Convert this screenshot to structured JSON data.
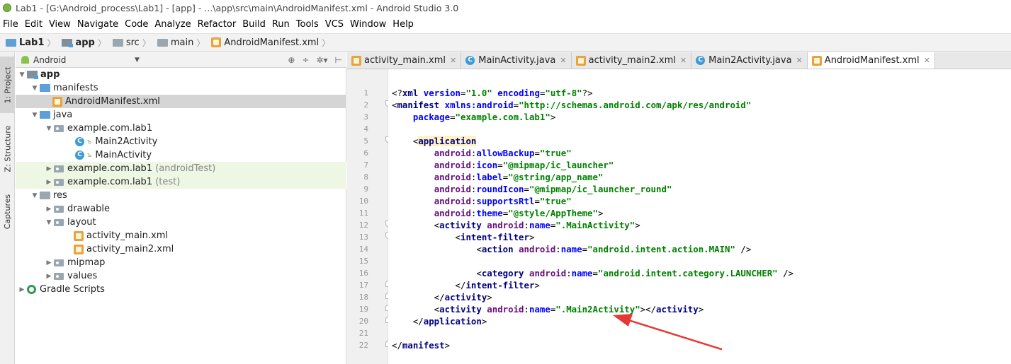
{
  "window": {
    "title": "Lab1 - [G:\\Android_process\\Lab1] - [app] - ...\\app\\src\\main\\AndroidManifest.xml - Android Studio 3.0"
  },
  "menu": [
    "File",
    "Edit",
    "View",
    "Navigate",
    "Code",
    "Analyze",
    "Refactor",
    "Build",
    "Run",
    "Tools",
    "VCS",
    "Window",
    "Help"
  ],
  "breadcrumb": [
    "Lab1",
    "app",
    "src",
    "main",
    "AndroidManifest.xml"
  ],
  "left_strip": {
    "project": "1: Project",
    "structure": "Z: Structure",
    "captures": "Captures"
  },
  "project_panel": {
    "view": "Android",
    "tree": [
      {
        "label": "app",
        "extra": ""
      },
      {
        "label": "manifests",
        "extra": ""
      },
      {
        "label": "AndroidManifest.xml",
        "extra": ""
      },
      {
        "label": "java",
        "extra": ""
      },
      {
        "label": "example.com.lab1",
        "extra": ""
      },
      {
        "label": "Main2Activity",
        "extra": ""
      },
      {
        "label": "MainActivity",
        "extra": ""
      },
      {
        "label": "example.com.lab1",
        "extra": "(androidTest)"
      },
      {
        "label": "example.com.lab1",
        "extra": "(test)"
      },
      {
        "label": "res",
        "extra": ""
      },
      {
        "label": "drawable",
        "extra": ""
      },
      {
        "label": "layout",
        "extra": ""
      },
      {
        "label": "activity_main.xml",
        "extra": ""
      },
      {
        "label": "activity_main2.xml",
        "extra": ""
      },
      {
        "label": "mipmap",
        "extra": ""
      },
      {
        "label": "values",
        "extra": ""
      },
      {
        "label": "Gradle Scripts",
        "extra": ""
      }
    ]
  },
  "editor_tabs": [
    {
      "label": "activity_main.xml",
      "icon": "xml-file-icon",
      "active": false
    },
    {
      "label": "MainActivity.java",
      "icon": "java-class-icon",
      "active": false
    },
    {
      "label": "activity_main2.xml",
      "icon": "xml-file-icon",
      "active": false
    },
    {
      "label": "Main2Activity.java",
      "icon": "java-class-icon",
      "active": false
    },
    {
      "label": "AndroidManifest.xml",
      "icon": "manifest-file-icon",
      "active": true
    }
  ],
  "line_numbers": [
    "1",
    "2",
    "3",
    "4",
    "5",
    "6",
    "7",
    "8",
    "9",
    "10",
    "11",
    "12",
    "13",
    "14",
    "15",
    "16",
    "17",
    "18",
    "19",
    "20",
    "21",
    "22"
  ],
  "code": {
    "l1": {
      "a": "<?",
      "b": "xml",
      "c": " ",
      "d": "version",
      "e": "=",
      "f": "\"1.0\"",
      "g": " ",
      "h": "encoding",
      "i": "=",
      "j": "\"utf-8\"",
      "k": "?>"
    },
    "l2": {
      "a": "<",
      "b": "manifest",
      "c": " ",
      "d": "xmlns:",
      "e": "android",
      "f": "=",
      "g": "\"http://schemas.android.com/apk/res/android\""
    },
    "l3": {
      "a": "    ",
      "b": "package",
      "c": "=",
      "d": "\"example.com.lab1\"",
      "e": ">"
    },
    "l5": {
      "a": "    <",
      "b": "application"
    },
    "l6": {
      "a": "        ",
      "b": "android",
      "c": ":",
      "d": "allowBackup",
      "e": "=",
      "f": "\"true\""
    },
    "l7": {
      "a": "        ",
      "b": "android",
      "c": ":",
      "d": "icon",
      "e": "=",
      "f": "\"@mipmap/ic_launcher\""
    },
    "l8": {
      "a": "        ",
      "b": "android",
      "c": ":",
      "d": "label",
      "e": "=",
      "f": "\"@string/app_name\""
    },
    "l9": {
      "a": "        ",
      "b": "android",
      "c": ":",
      "d": "roundIcon",
      "e": "=",
      "f": "\"@mipmap/ic_launcher_round\""
    },
    "l10": {
      "a": "        ",
      "b": "android",
      "c": ":",
      "d": "supportsRtl",
      "e": "=",
      "f": "\"true\""
    },
    "l11": {
      "a": "        ",
      "b": "android",
      "c": ":",
      "d": "theme",
      "e": "=",
      "f": "\"@style/AppTheme\"",
      "g": ">"
    },
    "l12": {
      "a": "        <",
      "b": "activity",
      "c": " ",
      "d": "android",
      "e": ":",
      "f": "name",
      "g": "=",
      "h": "\".MainActivity\"",
      "i": ">"
    },
    "l13": {
      "a": "            <",
      "b": "intent-filter",
      "c": ">"
    },
    "l14": {
      "a": "                <",
      "b": "action",
      "c": " ",
      "d": "android",
      "e": ":",
      "f": "name",
      "g": "=",
      "h": "\"android.intent.action.MAIN\"",
      "i": " />"
    },
    "l16": {
      "a": "                <",
      "b": "category",
      "c": " ",
      "d": "android",
      "e": ":",
      "f": "name",
      "g": "=",
      "h": "\"android.intent.category.LAUNCHER\"",
      "i": " />"
    },
    "l17": {
      "a": "            </",
      "b": "intent-filter",
      "c": ">"
    },
    "l18": {
      "a": "        </",
      "b": "activity",
      "c": ">"
    },
    "l19": {
      "a": "        <",
      "b": "activity",
      "c": " ",
      "d": "android",
      "e": ":",
      "f": "name",
      "g": "=",
      "h": "\".Main2Activity\"",
      "i": "></",
      "j": "activity",
      "k": ">"
    },
    "l20": {
      "a": "    </",
      "b": "application",
      "c": ">"
    },
    "l22": {
      "a": "</",
      "b": "manifest",
      "c": ">"
    }
  },
  "colors": {
    "annotation_arrow": "#e53935",
    "selection": "#d5d5d5",
    "test_folder_bg": "#eef6e4"
  }
}
